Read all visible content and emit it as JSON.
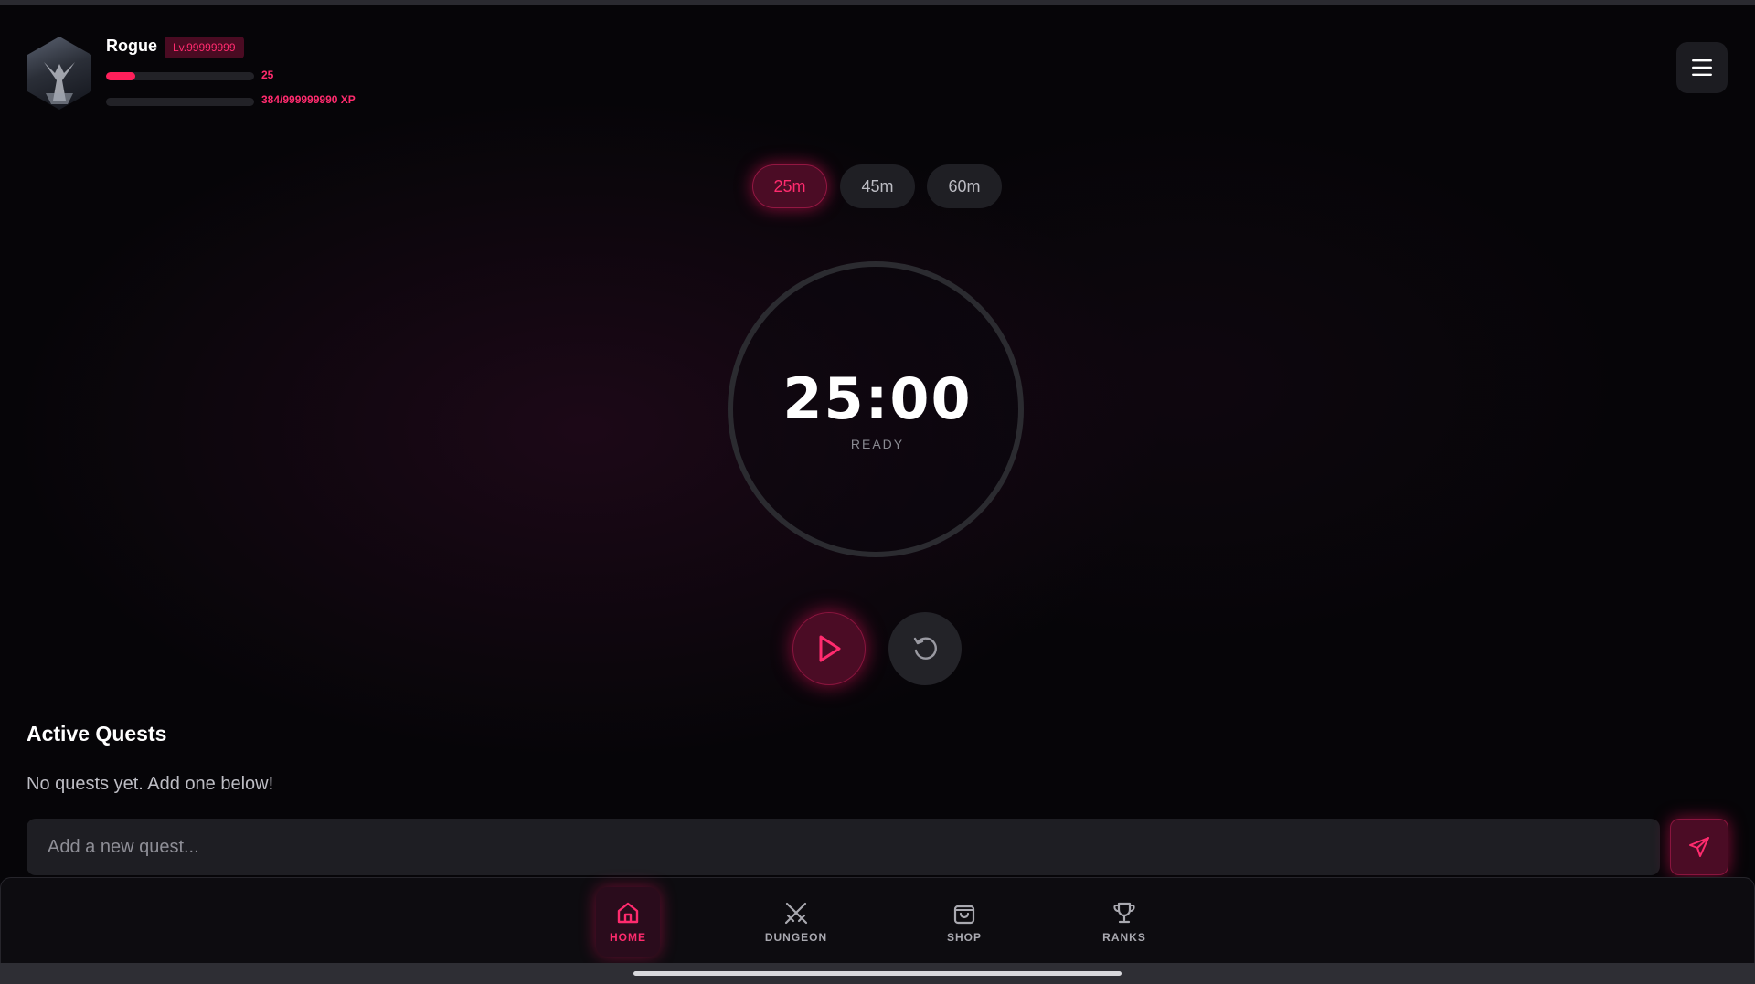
{
  "profile": {
    "name": "Rogue",
    "level_badge": "Lv.99999999",
    "hp_value": "25",
    "hp_fraction": 0.2,
    "xp_text": "384/999999990 XP",
    "xp_fraction": 0.0
  },
  "durations": {
    "options": [
      "25m",
      "45m",
      "60m"
    ],
    "selected": "25m"
  },
  "timer": {
    "time": "25:00",
    "status": "READY"
  },
  "quests": {
    "title": "Active Quests",
    "empty_message": "No quests yet. Add one below!",
    "input_placeholder": "Add a new quest...",
    "input_value": ""
  },
  "nav": {
    "items": [
      {
        "label": "HOME",
        "icon": "home-icon",
        "active": true
      },
      {
        "label": "DUNGEON",
        "icon": "crossed-swords-icon",
        "active": false
      },
      {
        "label": "SHOP",
        "icon": "shopping-bag-icon",
        "active": false
      },
      {
        "label": "RANKS",
        "icon": "trophy-icon",
        "active": false
      }
    ]
  },
  "colors": {
    "accent": "#ff2b6e",
    "accent_dark": "#4b0c25",
    "background": "#060508",
    "surface": "#1e1e23"
  }
}
